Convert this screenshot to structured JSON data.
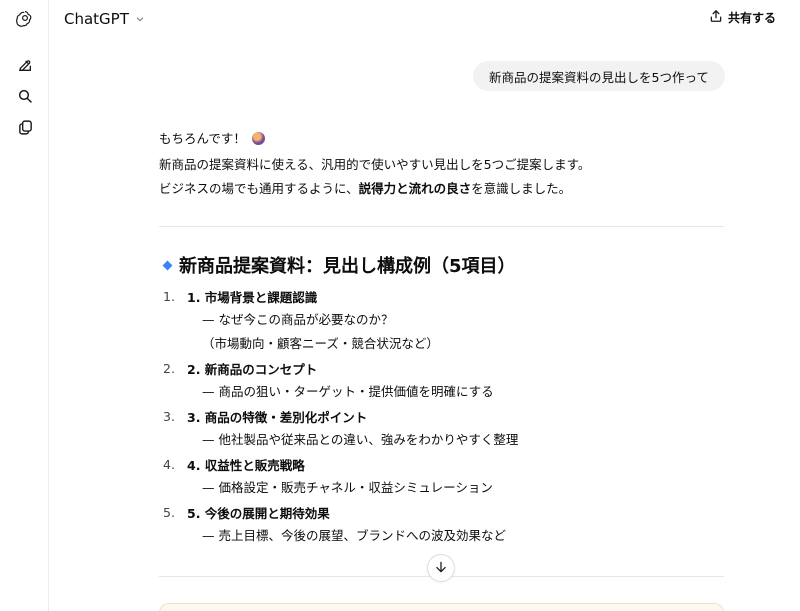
{
  "header": {
    "model_label": "ChatGPT",
    "share_label": "共有する"
  },
  "conversation": {
    "user_message": "新商品の提案資料の見出しを5つ作って",
    "assistant": {
      "greeting": "もちろんです！",
      "greeting_emoji": "🙌",
      "intro_line": "新商品の提案資料に使える、汎用的で使いやすい見出しを5つご提案します。",
      "note_prefix": "ビジネスの場でも通用するように、",
      "note_bold": "説得力と流れの良さ",
      "note_suffix": "を意識しました。",
      "section_title": "新商品提案資料：見出し構成例（5項目）",
      "items": [
        {
          "num": "1.",
          "title": "1. 市場背景と課題認識",
          "lines": [
            "— なぜ今この商品が必要なのか？",
            "（市場動向・顧客ニーズ・競合状況など）"
          ]
        },
        {
          "num": "2.",
          "title": "2. 新商品のコンセプト",
          "lines": [
            "— 商品の狙い・ターゲット・提供価値を明確にする"
          ]
        },
        {
          "num": "3.",
          "title": "3. 商品の特徴・差別化ポイント",
          "lines": [
            "— 他社製品や従来品との違い、強みをわかりやすく整理"
          ]
        },
        {
          "num": "4.",
          "title": "4. 収益性と販売戦略",
          "lines": [
            "— 価格設定・販売チャネル・収益シミュレーション"
          ]
        },
        {
          "num": "5.",
          "title": "5. 今後の展開と期待効果",
          "lines": [
            "— 売上目標、今後の展望、ブランドへの波及効果など"
          ]
        }
      ]
    }
  },
  "icons": {
    "logo": "openai-logo-icon",
    "new_chat": "new-chat-icon",
    "search": "search-icon",
    "library": "library-icon",
    "share": "share-icon",
    "scroll_down": "arrow-down-icon"
  },
  "colors": {
    "accent_diamond": "#3b82f6",
    "user_bubble_bg": "#f2f2f2"
  }
}
